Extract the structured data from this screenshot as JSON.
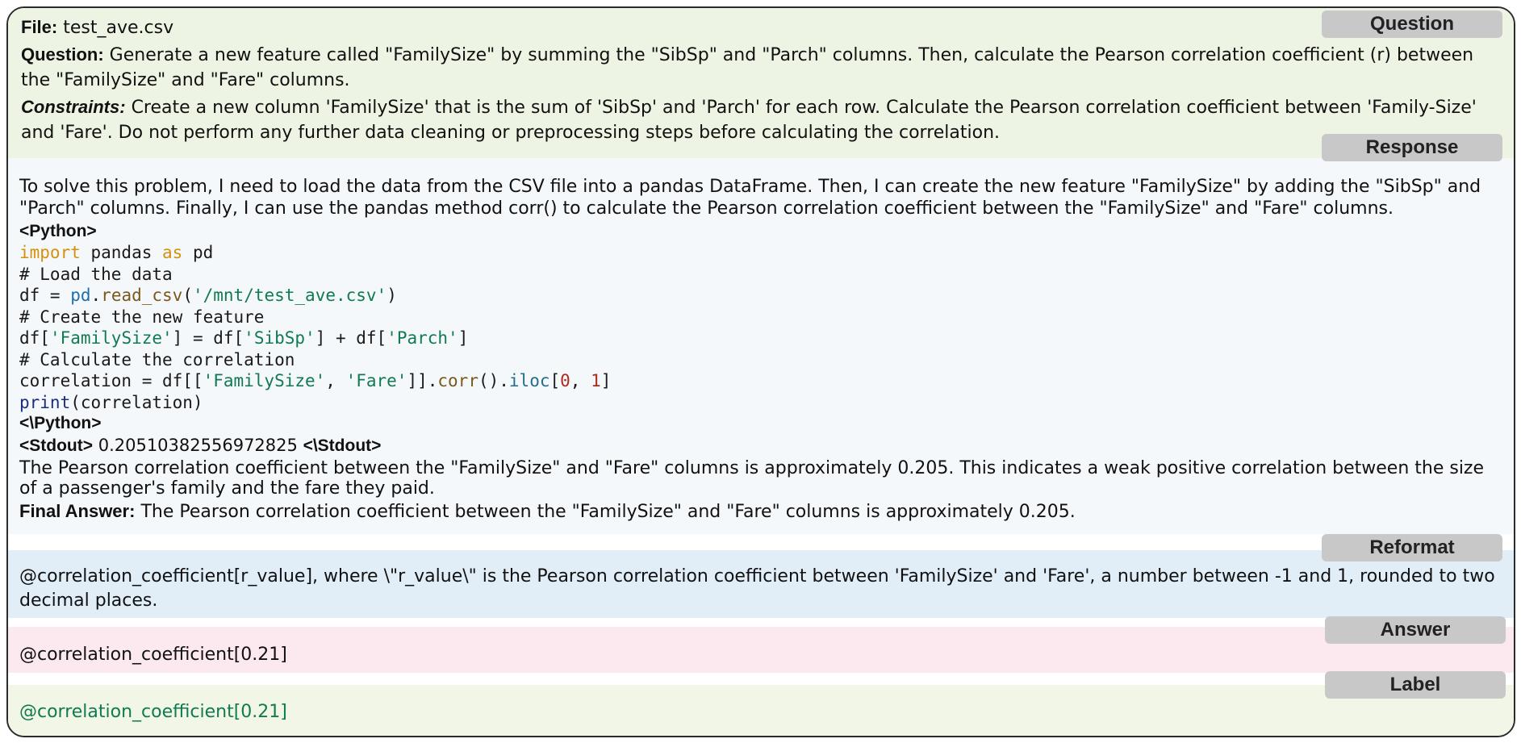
{
  "question": {
    "tag": "Question",
    "file_label": "File:",
    "file_name": "test_ave.csv",
    "question_label": "Question:",
    "question_text": "Generate a new feature called \"FamilySize\" by summing the \"SibSp\" and \"Parch\" columns. Then, calculate the Pearson correlation coefficient (r) between the \"FamilySize\" and \"Fare\" columns.",
    "constraints_label": "Constraints:",
    "constraints_text": "Create a new column 'FamilySize' that is the sum of 'SibSp' and 'Parch' for each row. Calculate the Pearson correlation coefficient between 'Family-Size' and 'Fare'. Do not perform any further data cleaning or preprocessing steps before calculating the correlation."
  },
  "response": {
    "tag": "Response",
    "intro": "To solve this problem, I need to load the data from the CSV file into a pandas DataFrame. Then, I can create the new feature \"FamilySize\" by adding the \"SibSp\" and \"Parch\" columns. Finally, I can use the pandas method corr() to calculate the Pearson correlation coefficient between the \"FamilySize\" and \"Fare\" columns.",
    "python_open": "<Python>",
    "python_close": "<\\Python>",
    "code": {
      "l1_kw1": "import",
      "l1_mid": " pandas ",
      "l1_kw2": "as",
      "l1_end": " pd",
      "l2": "# Load the data",
      "l3_a": "df = ",
      "l3_mod": "pd",
      "l3_dot": ".",
      "l3_fn": "read_csv",
      "l3_p1": "(",
      "l3_str": "'/mnt/test_ave.csv'",
      "l3_p2": ")",
      "l4": "# Create the new feature",
      "l5_a": "df[",
      "l5_s1": "'FamilySize'",
      "l5_b": "] = df[",
      "l5_s2": "'SibSp'",
      "l5_c": "] + df[",
      "l5_s3": "'Parch'",
      "l5_d": "]",
      "l6": "# Calculate the correlation",
      "l7_a": "correlation = df[[",
      "l7_s1": "'FamilySize'",
      "l7_b": ", ",
      "l7_s2": "'Fare'",
      "l7_c": "]].",
      "l7_fn": "corr",
      "l7_d": "().",
      "l7_attr": "iloc",
      "l7_e": "[",
      "l7_n1": "0",
      "l7_f": ", ",
      "l7_n2": "1",
      "l7_g": "]",
      "l8_bi": "print",
      "l8_rest": "(correlation)"
    },
    "stdout_open": "<Stdout>",
    "stdout_value": "0.20510382556972825",
    "stdout_close": "<\\Stdout>",
    "explanation": "The Pearson correlation coefficient between the \"FamilySize\" and \"Fare\" columns is approximately 0.205. This indicates a weak positive correlation between the size of a passenger's family and the fare they paid.",
    "final_label": "Final Answer:",
    "final_text": "The Pearson correlation coefficient between the \"FamilySize\" and \"Fare\" columns is approximately 0.205."
  },
  "reformat": {
    "tag": "Reformat",
    "text": "@correlation_coefficient[r_value], where \\\"r_value\\\" is the Pearson correlation coefficient between 'FamilySize' and 'Fare', a number between -1 and 1, rounded to two decimal places."
  },
  "answer": {
    "tag": "Answer",
    "text": "@correlation_coefficient[0.21]"
  },
  "label": {
    "tag": "Label",
    "text": "@correlation_coefficient[0.21]"
  },
  "colors": {
    "question_bg": "#eef4e4",
    "response_bg": "#f5f8fb",
    "reformat_bg": "#e1eef8",
    "answer_bg": "#fbe9ef",
    "label_bg": "#f2f6e7",
    "label_text": "#107a50"
  }
}
